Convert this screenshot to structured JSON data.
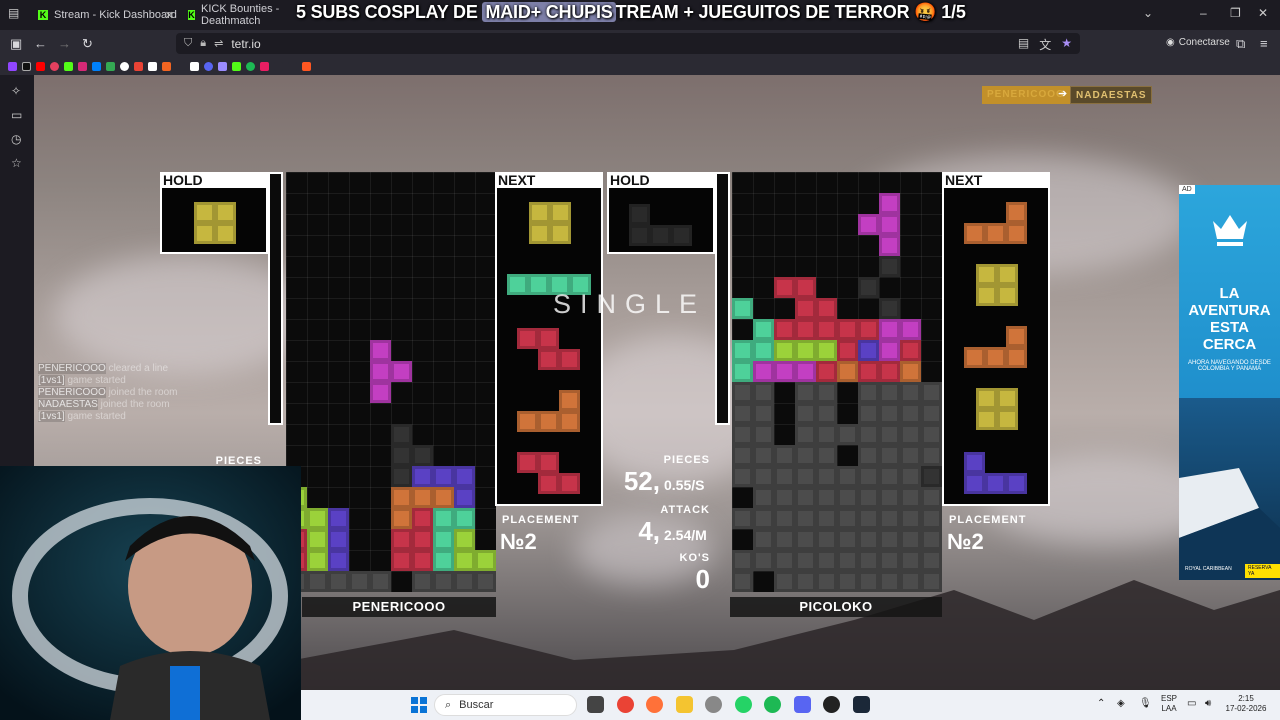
{
  "browser": {
    "tabs": [
      {
        "label": "Stream - Kick Dashboard",
        "favicon": "K"
      },
      {
        "label": "KICK Bounties - Deathmatch",
        "favicon": "K"
      }
    ],
    "overlay_title_before": "5 SUBS COSPLAY DE ",
    "overlay_title_highlight": "MAID+ CHUPIS",
    "overlay_title_after": "TREAM + JUEGUITOS DE TERROR 🤬 1/5",
    "url": "tetr.io",
    "connect_label": "Conectarse"
  },
  "game": {
    "top_players": [
      "PENERICOOO",
      "NADAESTAS"
    ],
    "single_text": "SINGLE",
    "hold_label": "HOLD",
    "next_label": "NEXT",
    "pieces_label": "PIECES",
    "attack_label": "ATTACK",
    "kos_label": "KO'S",
    "placement_label": "PLACEMENT",
    "left": {
      "name": "PENERICOOO",
      "placement": "№2",
      "pieces_small": "PIECES"
    },
    "right": {
      "name": "PICOLOKO",
      "placement": "№2"
    },
    "stats": {
      "pieces": "52,",
      "pps": "0.55/S",
      "attack": "4,",
      "apm": "2.54/M",
      "kos": "0"
    }
  },
  "chatlog": [
    {
      "user": "PENERICOOO",
      "text": "  cleared a line"
    },
    {
      "user": "[1vs1]",
      "text": "  game started"
    },
    {
      "user": "PENERICOOO",
      "text": "  joined the room"
    },
    {
      "user": "NADAESTAS",
      "text": "  joined the room"
    },
    {
      "user": "[1vs1]",
      "text": "  game started"
    }
  ],
  "ad": {
    "tag": "AD",
    "headline": "LA AVENTURA ESTA CERCA",
    "sub": "AHORA NAVEGANDO DESDE COLOMBIA Y PANAMÁ",
    "brand": "ROYAL CARIBBEAN",
    "cta": "RESERVA YA"
  },
  "taskbar": {
    "search_placeholder": "Buscar",
    "lang": "ESP",
    "lang2": "LAA",
    "time": "2:15",
    "date": "17-02-2026"
  },
  "colors": {
    "o_piece": "#c6b73f",
    "i_piece": "#4ed19a",
    "z_piece": "#c7344a",
    "l_piece": "#d0743a",
    "t_piece": "#c33fc2",
    "j_piece": "#5a41c4",
    "s_piece": "#9bd23a",
    "garbage": "#4c4c4c"
  }
}
